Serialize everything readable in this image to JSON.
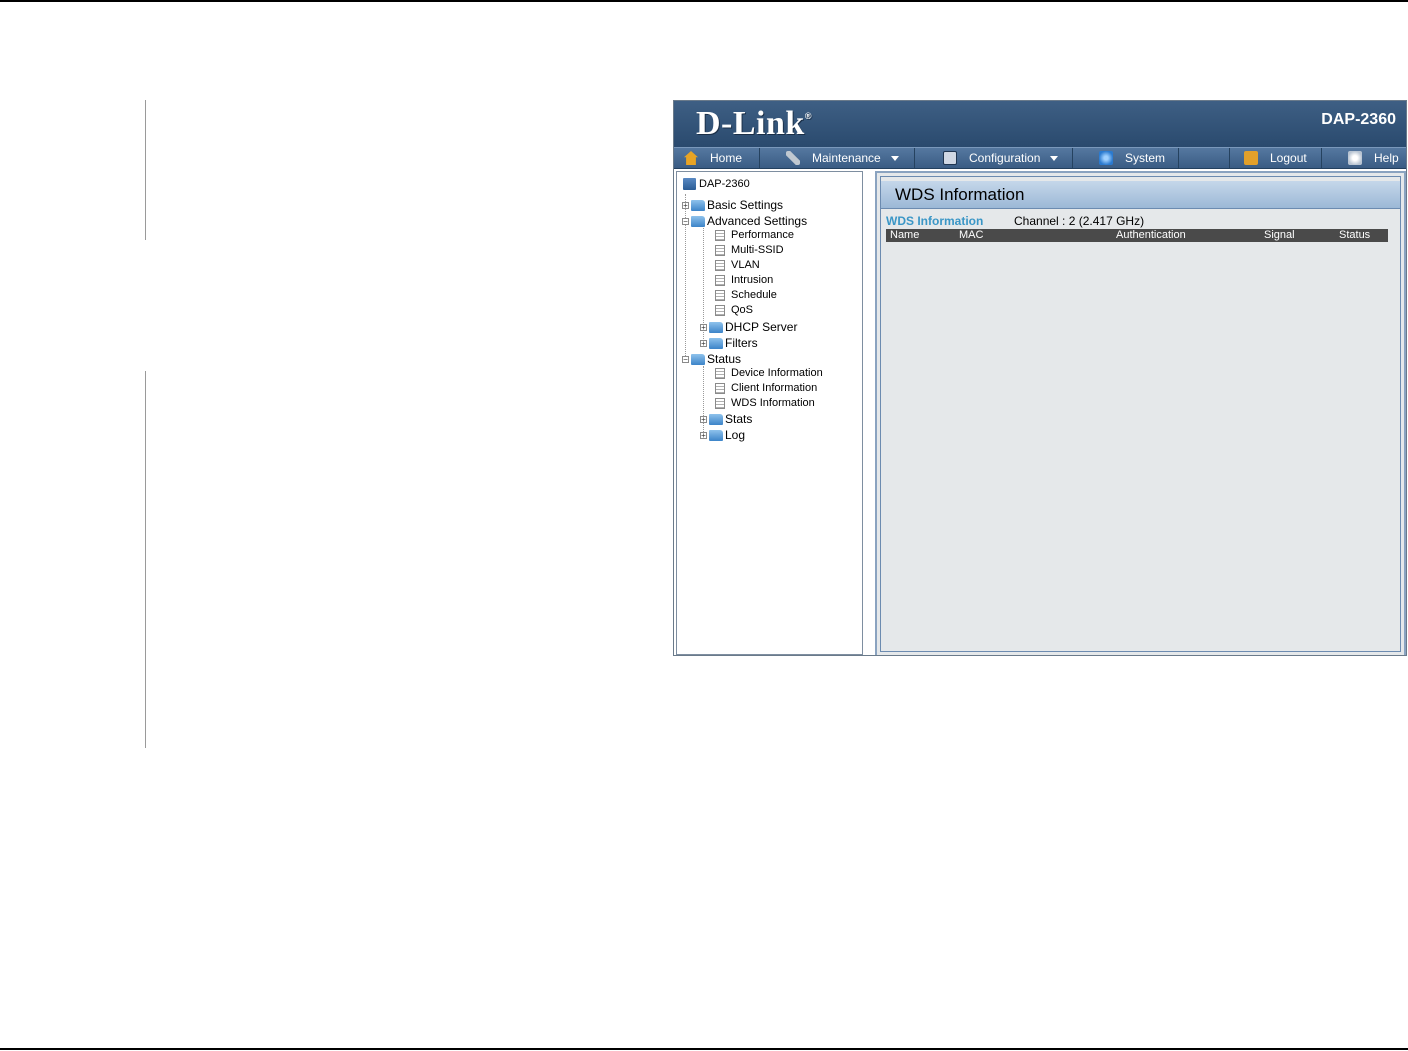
{
  "banner": {
    "logo": "D-Link",
    "registered": "®",
    "model": "DAP-2360"
  },
  "nav": {
    "home": "Home",
    "maintenance": "Maintenance",
    "configuration": "Configuration",
    "system": "System",
    "logout": "Logout",
    "help": "Help"
  },
  "tree": {
    "root": "DAP-2360",
    "basic": "Basic Settings",
    "advanced": "Advanced Settings",
    "advanced_items": [
      "Performance",
      "Multi-SSID",
      "VLAN",
      "Intrusion",
      "Schedule",
      "QoS"
    ],
    "dhcp": "DHCP Server",
    "filters": "Filters",
    "status": "Status",
    "status_items": [
      "Device Information",
      "Client Information",
      "WDS Information"
    ],
    "stats": "Stats",
    "log": "Log"
  },
  "content": {
    "title": "WDS Information",
    "section_label": "WDS Information",
    "channel": "Channel : 2 (2.417 GHz)",
    "columns": [
      "Name",
      "MAC",
      "Authentication",
      "Signal",
      "Status"
    ]
  }
}
